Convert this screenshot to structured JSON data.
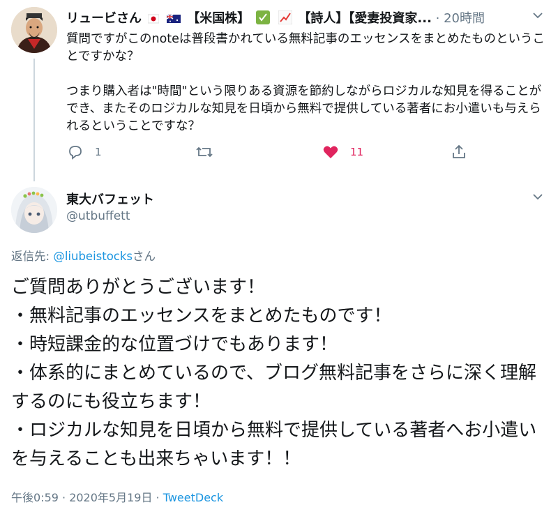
{
  "parent_tweet": {
    "display_name": "リュービさん",
    "name_suffix": "【米国株】",
    "name_suffix2": "【詩人】【愛妻投資家...",
    "time": "20時間",
    "text": "質問ですがこのnoteは普段書かれている無料記事のエッセンスをまとめたものということですかな？\n\nつまり購入者は\"時間\"という限りある資源を節約しながらロジカルな知見を得ることができ、またそのロジカルな知見を日頃から無料で提供している著者にお小遣いも与えられるということですな？",
    "reply_count": "1",
    "like_count": "11"
  },
  "main_tweet": {
    "display_name": "東大バフェット",
    "handle": "@utbuffett",
    "reply_prefix": "返信先: ",
    "reply_mention": "@liubeistocks",
    "reply_suffix": "さん",
    "text": "ご質問ありがとうございます！\n・無料記事のエッセンスをまとめたものです！\n・時短課金的な位置づけでもあります！\n・体系的にまとめているので、ブログ無料記事をさらに深く理解するのにも役立ちます！\n・ロジカルな知見を日頃から無料で提供している著者へお小遣いを与えることも出来ちゃいます！！",
    "timestamp": "午後0:59 · 2020年5月19日",
    "separator": " · ",
    "source": "TweetDeck"
  },
  "colors": {
    "link": "#1b95e0",
    "muted": "#657786",
    "like": "#e0245e",
    "text": "#14171a"
  },
  "icons": [
    "reply-icon",
    "retweet-icon",
    "like-icon",
    "share-icon",
    "chevron-down-icon"
  ]
}
